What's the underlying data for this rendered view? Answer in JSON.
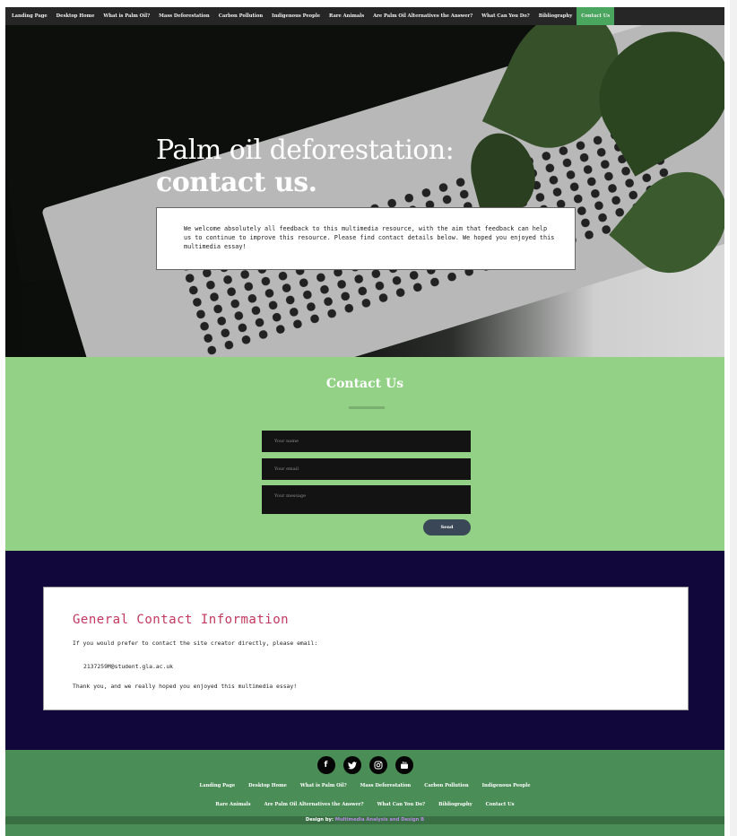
{
  "nav": {
    "items": [
      {
        "label": "Landing Page"
      },
      {
        "label": "Desktop Home"
      },
      {
        "label": "What is Palm Oil?"
      },
      {
        "label": "Mass Deforestation"
      },
      {
        "label": "Carbon Pollution"
      },
      {
        "label": "Indigenous People"
      },
      {
        "label": "Rare Animals"
      },
      {
        "label": "Are Palm Oil Alternatives the Answer?"
      },
      {
        "label": "What Can You Do?"
      },
      {
        "label": "Bibliography"
      },
      {
        "label": "Contact Us"
      }
    ],
    "active": "Contact Us",
    "active_color": "#4aa55e"
  },
  "hero": {
    "title_line1": "Palm oil deforestation:",
    "title_line2": "contact us.",
    "intro": "We welcome absolutely all feedback to this multimedia resource, with the aim that feedback can help us to continue to improve this resource. Please find contact details below. We hoped you enjoyed this multimedia essay!"
  },
  "contact": {
    "heading": "Contact Us",
    "name_placeholder": "Your name",
    "email_placeholder": "Your email",
    "message_placeholder": "Your message",
    "send_label": "Send",
    "bg_color": "#92d186"
  },
  "info": {
    "heading": "General Contact Information",
    "line1": "If you would prefer to contact the site creator directly, please email:",
    "email": "2137259M@student.gla.ac.uk",
    "line2": "Thank you, and we really hoped you enjoyed this multimedia essay!",
    "heading_color": "#c2385e",
    "bg_color": "#12073a"
  },
  "footer": {
    "socials": [
      {
        "icon": "facebook-icon",
        "glyph": "f"
      },
      {
        "icon": "twitter-icon",
        "glyph": "t"
      },
      {
        "icon": "instagram-icon",
        "glyph": "◎"
      },
      {
        "icon": "youtube-icon",
        "glyph": "▶"
      }
    ],
    "links_row1": [
      "Landing Page",
      "Desktop Home",
      "What is Palm Oil?",
      "Mass Deforestation",
      "Carbon Pollution",
      "Indigenous People"
    ],
    "links_row2": [
      "Rare Animals",
      "Are Palm Oil Alternatives the Answer?",
      "What Can You Do?",
      "Bibliography",
      "Contact Us"
    ],
    "credit_prefix": "Design by:",
    "credit_link": "Multimedia Analysis and Design B",
    "bg_color": "#4a8d56"
  }
}
